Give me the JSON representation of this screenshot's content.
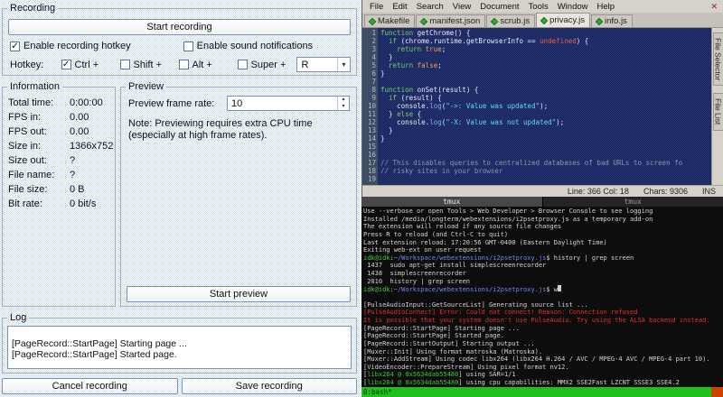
{
  "icons": {
    "check": "✓",
    "chevron_down": "▾",
    "spin_up": "▴",
    "spin_down": "▾",
    "close": "✕"
  },
  "colors": {
    "dialog_checker": "#ccdcee",
    "editor_bg": "#18245a",
    "tmux_bar_green": "#1fbf1c",
    "error_red": "#ee2b2b",
    "prompt_green": "#44cc44",
    "path_blue": "#7287ec"
  },
  "recorder": {
    "recording": {
      "title": "Recording",
      "start_button": "Start recording",
      "options": [
        {
          "label": "Enable recording hotkey",
          "checked": true
        },
        {
          "label": "Enable sound notifications",
          "checked": false
        }
      ],
      "hotkey_label": "Hotkey:",
      "modifiers": [
        {
          "label": "Ctrl +",
          "checked": true
        },
        {
          "label": "Shift +",
          "checked": false
        },
        {
          "label": "Alt +",
          "checked": false
        },
        {
          "label": "Super +",
          "checked": false
        }
      ],
      "hotkey_key": "R"
    },
    "information": {
      "title": "Information",
      "rows": [
        {
          "label": "Total time:",
          "value": "0:00:00"
        },
        {
          "label": "FPS in:",
          "value": "0.00"
        },
        {
          "label": "FPS out:",
          "value": "0.00"
        },
        {
          "label": "Size in:",
          "value": "1366x752"
        },
        {
          "label": "Size out:",
          "value": "?"
        },
        {
          "label": "File name:",
          "value": "?"
        },
        {
          "label": "File size:",
          "value": "0 B"
        },
        {
          "label": "Bit rate:",
          "value": "0 bit/s"
        }
      ]
    },
    "preview": {
      "title": "Preview",
      "frame_rate_label": "Preview frame rate:",
      "frame_rate_value": "10",
      "note": "Note: Previewing requires extra CPU time (especially at high frame rates).",
      "start_button": "Start preview"
    },
    "log": {
      "title": "Log",
      "lines": [
        "[PageRecord::StartPage] Starting page ...",
        "[PageRecord::StartPage] Started page."
      ]
    },
    "footer": {
      "cancel_button": "Cancel recording",
      "save_button": "Save recording"
    }
  },
  "editor": {
    "menu": [
      "File",
      "Edit",
      "Search",
      "View",
      "Document",
      "Tools",
      "Window",
      "Help"
    ],
    "tabs": [
      {
        "label": "Makefile",
        "active": false
      },
      {
        "label": "manifest.json",
        "active": false
      },
      {
        "label": "scrub.js",
        "active": false
      },
      {
        "label": "privacy.js",
        "active": true
      },
      {
        "label": "info.js",
        "active": false
      }
    ],
    "code_lines": [
      [
        {
          "t": "function",
          "c": "k"
        },
        {
          "t": " getChrome() {",
          "c": "p"
        }
      ],
      [
        {
          "t": "  ",
          "c": "p"
        },
        {
          "t": "if",
          "c": "k"
        },
        {
          "t": " (chrome.runtime.getBrowserInfo == ",
          "c": "p"
        },
        {
          "t": "undefined",
          "c": "u"
        },
        {
          "t": ") {",
          "c": "p"
        }
      ],
      [
        {
          "t": "    ",
          "c": "p"
        },
        {
          "t": "return",
          "c": "k"
        },
        {
          "t": " ",
          "c": "p"
        },
        {
          "t": "true",
          "c": "l"
        },
        {
          "t": ";",
          "c": "p"
        }
      ],
      [
        {
          "t": "  }",
          "c": "p"
        }
      ],
      [
        {
          "t": "  ",
          "c": "p"
        },
        {
          "t": "return",
          "c": "k"
        },
        {
          "t": " ",
          "c": "p"
        },
        {
          "t": "false",
          "c": "l"
        },
        {
          "t": ";",
          "c": "p"
        }
      ],
      [
        {
          "t": "}",
          "c": "p"
        }
      ],
      [],
      [
        {
          "t": "function",
          "c": "k"
        },
        {
          "t": " onSet(result) {",
          "c": "p"
        }
      ],
      [
        {
          "t": "  ",
          "c": "p"
        },
        {
          "t": "if",
          "c": "k"
        },
        {
          "t": " (result) {",
          "c": "p"
        }
      ],
      [
        {
          "t": "    console.",
          "c": "p"
        },
        {
          "t": "log",
          "c": "f"
        },
        {
          "t": "(",
          "c": "p"
        },
        {
          "t": "\"->: Value was updated\"",
          "c": "s"
        },
        {
          "t": ");",
          "c": "p"
        }
      ],
      [
        {
          "t": "  } ",
          "c": "p"
        },
        {
          "t": "else",
          "c": "k"
        },
        {
          "t": " {",
          "c": "p"
        }
      ],
      [
        {
          "t": "    console.",
          "c": "p"
        },
        {
          "t": "log",
          "c": "f"
        },
        {
          "t": "(",
          "c": "p"
        },
        {
          "t": "\"-X: Value was not updated\"",
          "c": "s"
        },
        {
          "t": ");",
          "c": "p"
        }
      ],
      [
        {
          "t": "  }",
          "c": "p"
        }
      ],
      [
        {
          "t": "}",
          "c": "p"
        }
      ],
      [],
      [],
      [
        {
          "t": "// This disables queries to centralized databases of bad URLs to screen fo",
          "c": "c"
        }
      ],
      [
        {
          "t": "// risky sites in your browser",
          "c": "c"
        }
      ],
      []
    ],
    "side_tabs": [
      "File Selector",
      "File List"
    ],
    "status": {
      "line_col": "Line: 366 Col: 18",
      "chars": "Chars: 9306",
      "mode": "INS"
    }
  },
  "terminal": {
    "window_titles": [
      "tmux",
      "tmux"
    ],
    "status_left": "0:bash*",
    "lines": [
      [
        {
          "t": "Use --verbose or open Tools > Web Developer > Browser Console to see logging",
          "c": "w"
        }
      ],
      [
        {
          "t": "Installed /media/longterm/webextensions/i2psetproxy.js as a temporary add-on",
          "c": "w"
        }
      ],
      [
        {
          "t": "The extension will reload if any source file changes",
          "c": "w"
        }
      ],
      [
        {
          "t": "Press R to reload (and Ctrl-C to quit)",
          "c": "w"
        }
      ],
      [
        {
          "t": "Last extension reload: 17:20:56 GMT-0400 (Eastern Daylight Time)",
          "c": "w"
        }
      ],
      [
        {
          "t": "Exiting web-ext on user request",
          "c": "w"
        }
      ],
      [
        {
          "t": "idk@idk",
          "c": "g"
        },
        {
          "t": ":",
          "c": "w"
        },
        {
          "t": "~/Workspace/webextensions/i2psetproxy.js",
          "c": "b"
        },
        {
          "t": "$ history | grep screen",
          "c": "w"
        }
      ],
      [
        {
          "t": " 1437  sudo apt-get install simplescreenrecorder",
          "c": "w"
        }
      ],
      [
        {
          "t": " 1438  simplescreenrecorder",
          "c": "w"
        }
      ],
      [
        {
          "t": " 2010  history | grep screen",
          "c": "w"
        }
      ],
      [
        {
          "t": "idk@idk",
          "c": "g"
        },
        {
          "t": ":",
          "c": "w"
        },
        {
          "t": "~/Workspace/webextensions/i2psetproxy.js",
          "c": "b"
        },
        {
          "t": "$ w",
          "c": "w"
        },
        {
          "t": "",
          "c": "cur"
        }
      ],
      [],
      [
        {
          "t": "[PulseAudioInput::GetSourceList] Generating source list ...",
          "c": "w"
        }
      ],
      [
        {
          "t": "[PulseAudioConnect] Error: Could not connect! Reason: Connection refused",
          "c": "r"
        }
      ],
      [
        {
          "t": "It is possible that your system doesn't use PulseAudio. Try using the ALSA backend instead.",
          "c": "r"
        }
      ],
      [
        {
          "t": "[PageRecord::StartPage] Starting page ...",
          "c": "w"
        }
      ],
      [
        {
          "t": "[PageRecord::StartPage] Started page.",
          "c": "w"
        }
      ],
      [
        {
          "t": "[PageRecord::StartOutput] Starting output ...",
          "c": "w"
        }
      ],
      [
        {
          "t": "[Muxer::Init] Using format matroska (Matroska).",
          "c": "w"
        }
      ],
      [
        {
          "t": "[Muxer::AddStream] Using codec libx264 (libx264 H.264 / AVC / MPEG-4 AVC / MPEG-4 part 10).",
          "c": "w"
        }
      ],
      [
        {
          "t": "[VideoEncoder::PrepareStream] Using pixel format nv12.",
          "c": "w"
        }
      ],
      [
        {
          "t": "[",
          "c": "w"
        },
        {
          "t": "libx264 @ 0x5634dab55480",
          "c": "lib"
        },
        {
          "t": "] using SAR=1/1",
          "c": "w"
        }
      ],
      [
        {
          "t": "[",
          "c": "w"
        },
        {
          "t": "libx264 @ 0x5634dab55480",
          "c": "lib"
        },
        {
          "t": "] using cpu capabilities: MMX2 SSE2Fast LZCNT SSSE3 SSE4.2",
          "c": "w"
        }
      ]
    ]
  }
}
